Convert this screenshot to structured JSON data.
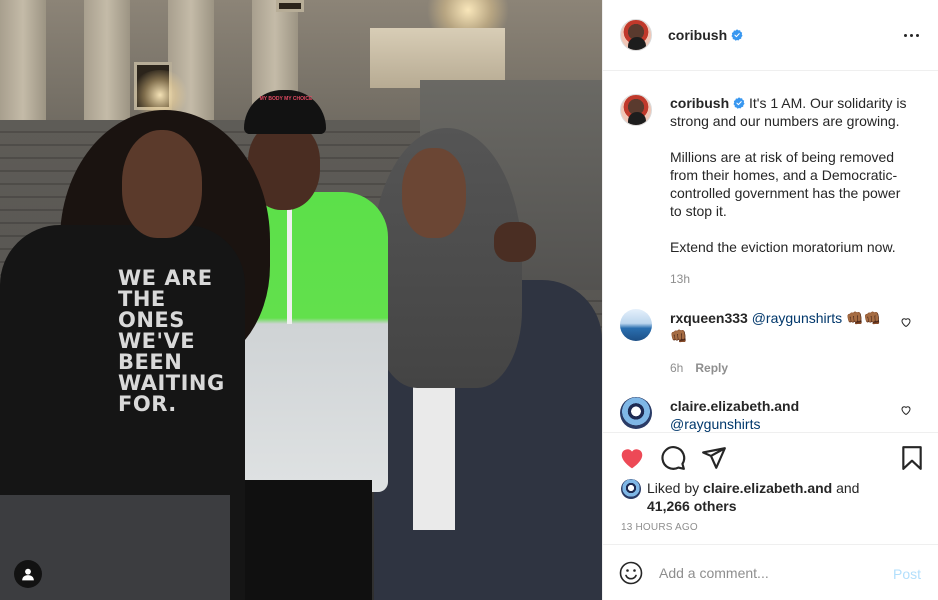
{
  "post": {
    "username": "coribush",
    "verified": true,
    "more_icon": "more-horizontal-icon",
    "shirt_text": "WE ARE THE ONES WE'VE BEEN WAITING FOR.",
    "cap_text": "MY BODY MY CHOICE"
  },
  "caption": {
    "username": "coribush",
    "paragraphs": [
      "It's 1 AM. Our solidarity is strong and our numbers are growing.",
      "Millions are at risk of being removed from their homes, and a Democratic-controlled government has the power to stop it.",
      "Extend the eviction moratorium now."
    ],
    "time": "13h"
  },
  "comments": [
    {
      "username": "rxqueen333",
      "mention": "@raygunshirts",
      "emoji": "👊🏾👊🏾👊🏾",
      "time": "6h",
      "reply_label": "Reply"
    },
    {
      "username": "claire.elizabeth.and",
      "mention": "@raygunshirts"
    }
  ],
  "likes": {
    "prefix": "Liked by",
    "user": "claire.elizabeth.and",
    "and": "and",
    "others": "41,266 others"
  },
  "posted": "13 HOURS AGO",
  "add_comment": {
    "placeholder": "Add a comment...",
    "post_label": "Post"
  },
  "colors": {
    "like_red": "#ed4956",
    "link": "#00376b",
    "verified_blue": "#3897f0",
    "post_disabled": "#b2dffc"
  }
}
